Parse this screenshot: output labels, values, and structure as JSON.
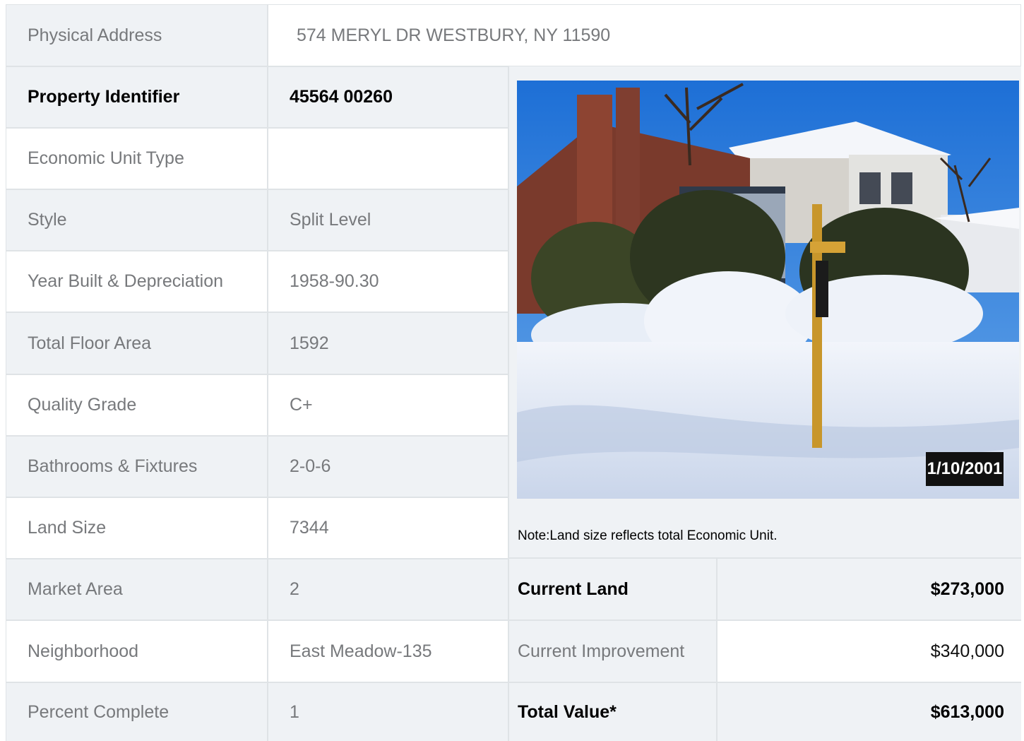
{
  "address": {
    "label": "Physical Address",
    "value": "574  MERYL DR  WESTBURY, NY  11590"
  },
  "rows": [
    {
      "label": "Property Identifier",
      "value": "45564  00260"
    },
    {
      "label": "Economic Unit Type",
      "value": ""
    },
    {
      "label": "Style",
      "value": "Split Level"
    },
    {
      "label": "Year Built & Depreciation",
      "value": "1958-90.30"
    },
    {
      "label": "Total Floor Area",
      "value": "1592"
    },
    {
      "label": "Quality Grade",
      "value": "C+"
    },
    {
      "label": "Bathrooms & Fixtures",
      "value": "2-0-6"
    },
    {
      "label": "Land Size",
      "value": "7344"
    },
    {
      "label": "Market Area",
      "value": "2"
    },
    {
      "label": "Neighborhood",
      "value": "East Meadow-135"
    },
    {
      "label": "Percent Complete",
      "value": "1"
    }
  ],
  "photo": {
    "date_stamp": "1/10/2001"
  },
  "note": "Note:Land size reflects total Economic Unit.",
  "valuation": [
    {
      "label": "Current Land",
      "value": "$273,000"
    },
    {
      "label": "Current Improvement",
      "value": "$340,000"
    },
    {
      "label": "Total Value*",
      "value": "$613,000"
    }
  ]
}
